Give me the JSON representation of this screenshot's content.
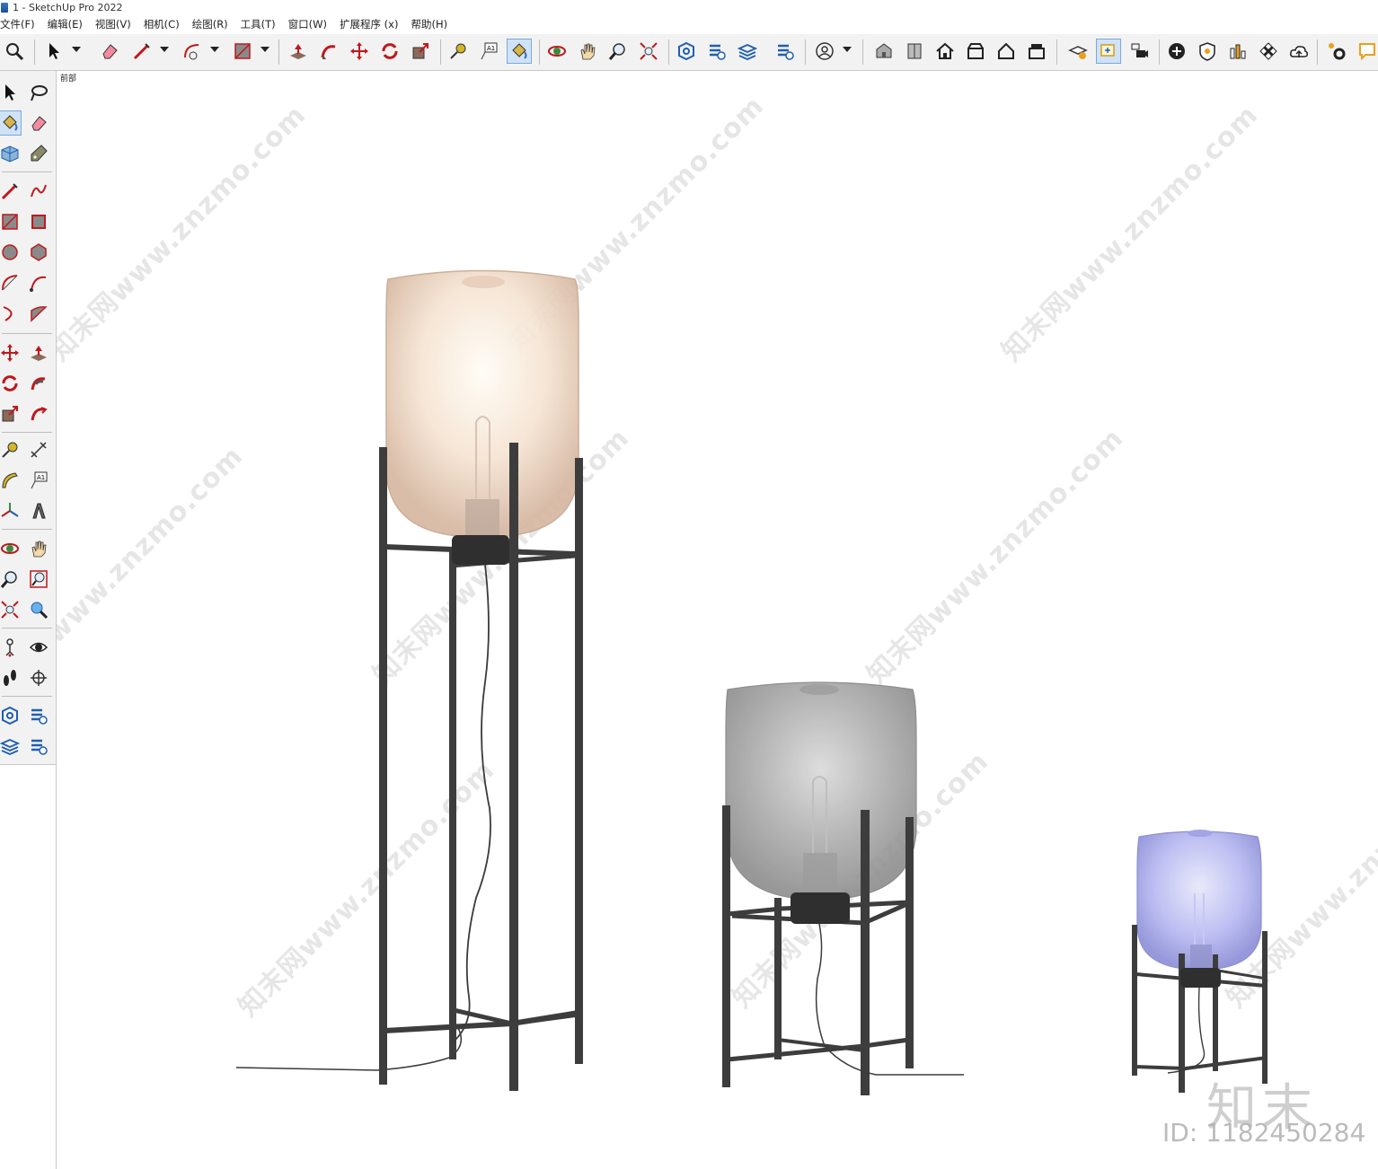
{
  "window": {
    "title": "1 - SketchUp Pro 2022"
  },
  "menu": {
    "items": [
      "文件(F)",
      "编辑(E)",
      "视图(V)",
      "相机(C)",
      "绘图(R)",
      "工具(T)",
      "窗口(W)",
      "扩展程序 (x)",
      "帮助(H)"
    ]
  },
  "toolbar": {
    "icons": [
      "zoom-icon",
      "select-icon",
      "eraser-icon",
      "pencil-icon",
      "arc-icon",
      "rectangle-icon",
      "push-pull-icon",
      "follow-me-icon",
      "move-icon",
      "rotate-icon",
      "scale-icon",
      "tape-measure-icon",
      "text-icon",
      "paint-bucket-icon",
      "orbit-icon",
      "pan-icon",
      "zoom-tool-icon",
      "zoom-extents-icon",
      "warehouse-icon",
      "extension-icon",
      "layers-icon",
      "solar-icon",
      "account-icon",
      "iso-view-icon",
      "front-view-icon",
      "home-view-icon",
      "top-view-icon",
      "right-view-icon",
      "back-view-icon",
      "style-icon",
      "section-icon",
      "camera-icon",
      "add-location-icon",
      "shield-icon",
      "chart-icon",
      "texture-icon",
      "cloud-icon",
      "settings-icon",
      "message-icon"
    ]
  },
  "viewport": {
    "scene_label": "前部",
    "watermark_text": "知末网www.znzmo.com",
    "brand_text": "知末",
    "id_text": "ID: 1182450284"
  },
  "colors": {
    "toolbar_bg": "#f2f2f2",
    "lamp_frame": "#3a3a3a",
    "shade_large": "#e8cdb5",
    "shade_medium": "#9e9e9e",
    "shade_small": "#a7a9ee"
  }
}
